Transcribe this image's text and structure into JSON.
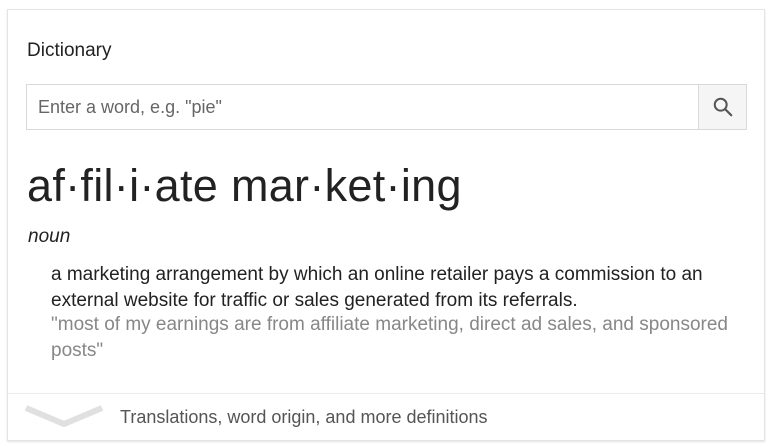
{
  "dictionary": {
    "section_title": "Dictionary",
    "search": {
      "placeholder": "Enter a word, e.g. \"pie\"",
      "value": "",
      "button_icon": "search-icon"
    },
    "entry": {
      "headword": "af·fil·i·ate mar·ket·ing",
      "part_of_speech": "noun",
      "definition": "a marketing arrangement by which an online retailer pays a commission to an external website for traffic or sales generated from its referrals.",
      "example": "\"most of my earnings are from affiliate marketing, direct ad sales, and sponsored posts\""
    },
    "footer": {
      "expand_icon": "chevron-down-icon",
      "label": "Translations, word origin, and more definitions"
    }
  }
}
